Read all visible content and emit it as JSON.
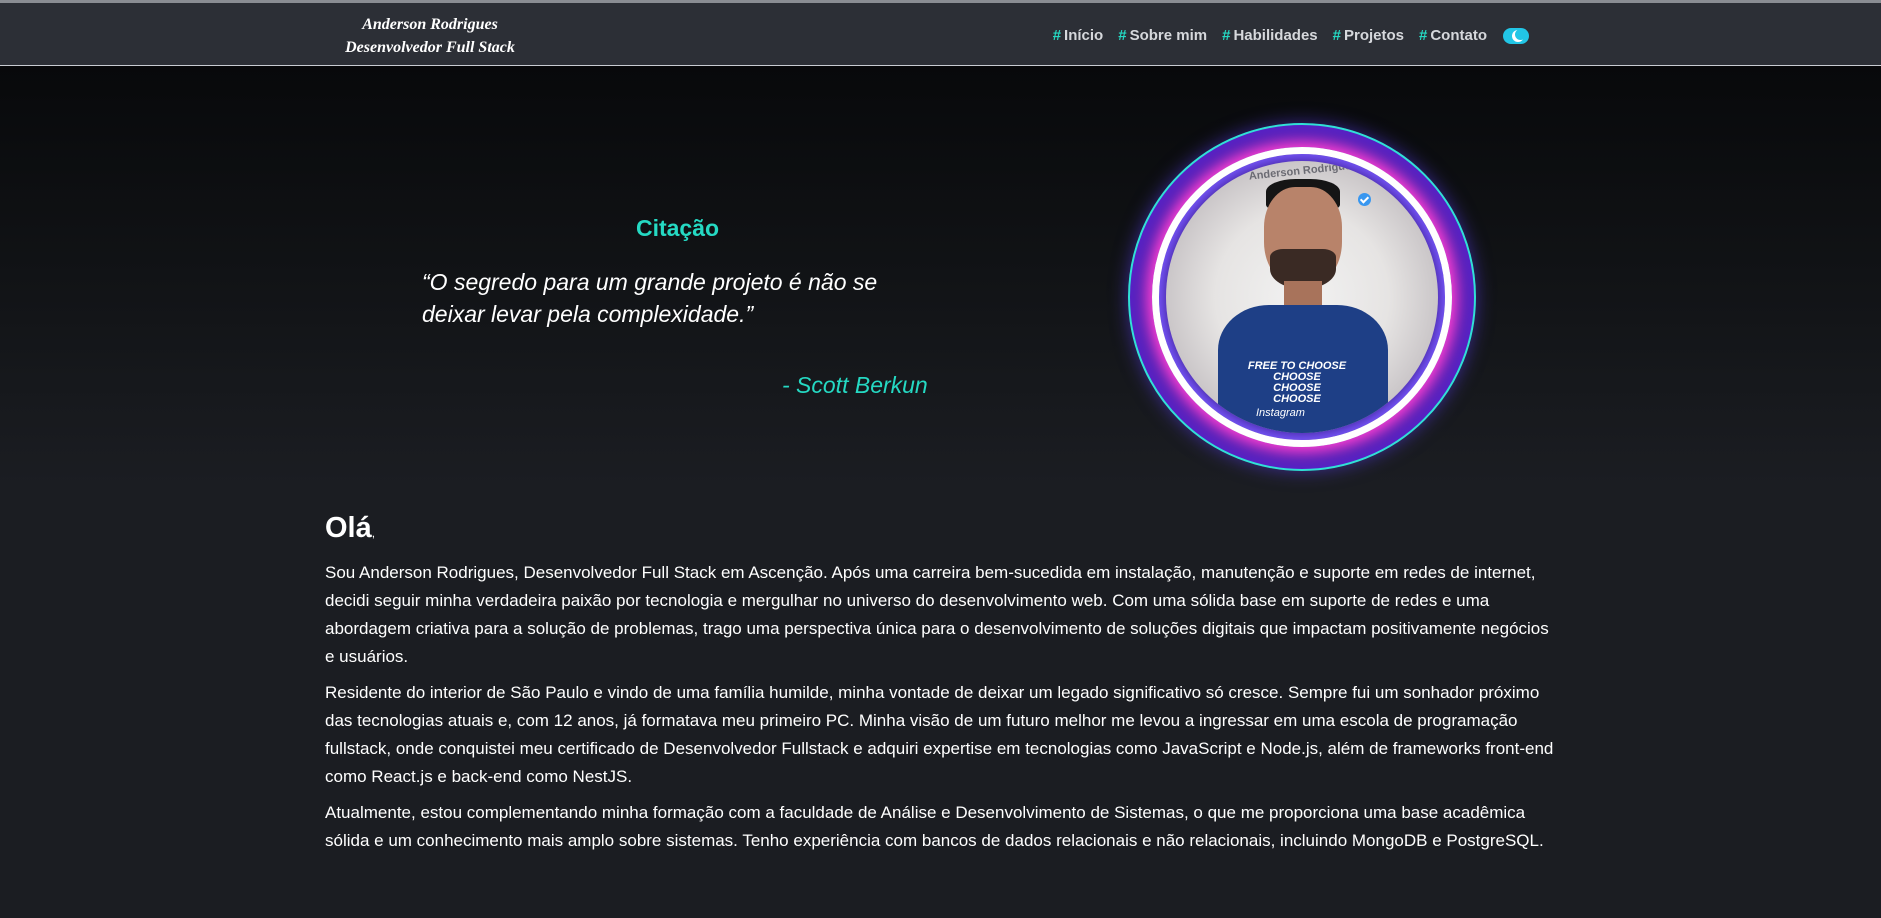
{
  "header": {
    "brand_name": "Anderson Rodrigues",
    "brand_role": "Desenvolvedor Full Stack",
    "nav_hash": "#",
    "nav": [
      {
        "label": "Início"
      },
      {
        "label": "Sobre mim"
      },
      {
        "label": "Habilidades"
      },
      {
        "label": "Projetos"
      },
      {
        "label": "Contato"
      }
    ],
    "theme_toggle_icon": "moon-icon"
  },
  "hero": {
    "quote_title": "Citação",
    "quote_text": "“O segredo para um grande projeto é não se deixar levar pela complexidade.”",
    "quote_author": "- Scott Berkun",
    "avatar": {
      "overlay_name": "Anderson Rodrigues",
      "shirt_lines": [
        "FREE TO CHOOSE",
        "CHOOSE",
        "CHOOSE",
        "CHOOSE"
      ],
      "watermark": "Instagram",
      "verified_icon": "verified-check-icon"
    }
  },
  "about": {
    "heading": "Olá",
    "heading_suffix": ",",
    "paragraphs": [
      "Sou Anderson Rodrigues, Desenvolvedor Full Stack em Ascenção. Após uma carreira bem-sucedida em instalação, manutenção e suporte em redes de internet, decidi seguir minha verdadeira paixão por tecnologia e mergulhar no universo do desenvolvimento web. Com uma sólida base em suporte de redes e uma abordagem criativa para a solução de problemas, trago uma perspectiva única para o desenvolvimento de soluções digitais que impactam positivamente negócios e usuários.",
      "Residente do interior de São Paulo e vindo de uma família humilde, minha vontade de deixar um legado significativo só cresce. Sempre fui um sonhador próximo das tecnologias atuais e, com 12 anos, já formatava meu primeiro PC. Minha visão de um futuro melhor me levou a ingressar em uma escola de programação fullstack, onde conquistei meu certificado de Desenvolvedor Fullstack e adquiri expertise em tecnologias como JavaScript e Node.js, além de frameworks front-end como React.js e back-end como NestJS.",
      "Atualmente, estou complementando minha formação com a faculdade de Análise e Desenvolvimento de Sistemas, o que me proporciona uma base acadêmica sólida e um conhecimento mais amplo sobre sistemas. Tenho experiência com bancos de dados relacionais e não relacionais, incluindo MongoDB e PostgreSQL."
    ]
  },
  "colors": {
    "accent": "#25d9c3",
    "nav_background": "#2c2f36",
    "page_background": "#1b1d22"
  }
}
